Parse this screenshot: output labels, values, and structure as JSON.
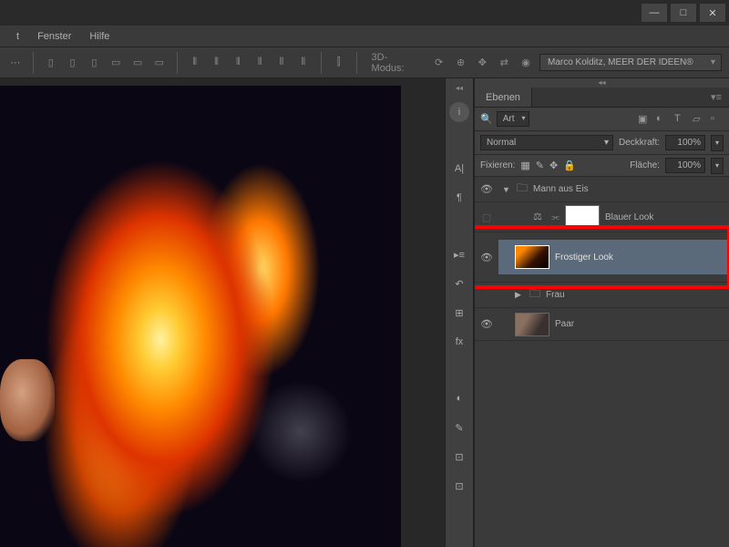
{
  "menu": {
    "item1": "t",
    "item2": "Fenster",
    "item3": "Hilfe"
  },
  "window_controls": {
    "min": "—",
    "max": "□",
    "close": "✕"
  },
  "options": {
    "mode_label": "3D-Modus:",
    "user": "Marco Kolditz, MEER DER IDEEN®"
  },
  "panel": {
    "tab": "Ebenen",
    "filter_kind": "Art",
    "blend_mode": "Normal",
    "opacity_label": "Deckkraft:",
    "opacity_value": "100%",
    "fill_label": "Fläche:",
    "fill_value": "100%",
    "lock_label": "Fixieren:"
  },
  "layers": {
    "group1": "Mann aus Eis",
    "adj1": "Blauer Look",
    "layer_selected": "Frostiger Look",
    "group2": "Frau",
    "layer_paar": "Paar"
  }
}
